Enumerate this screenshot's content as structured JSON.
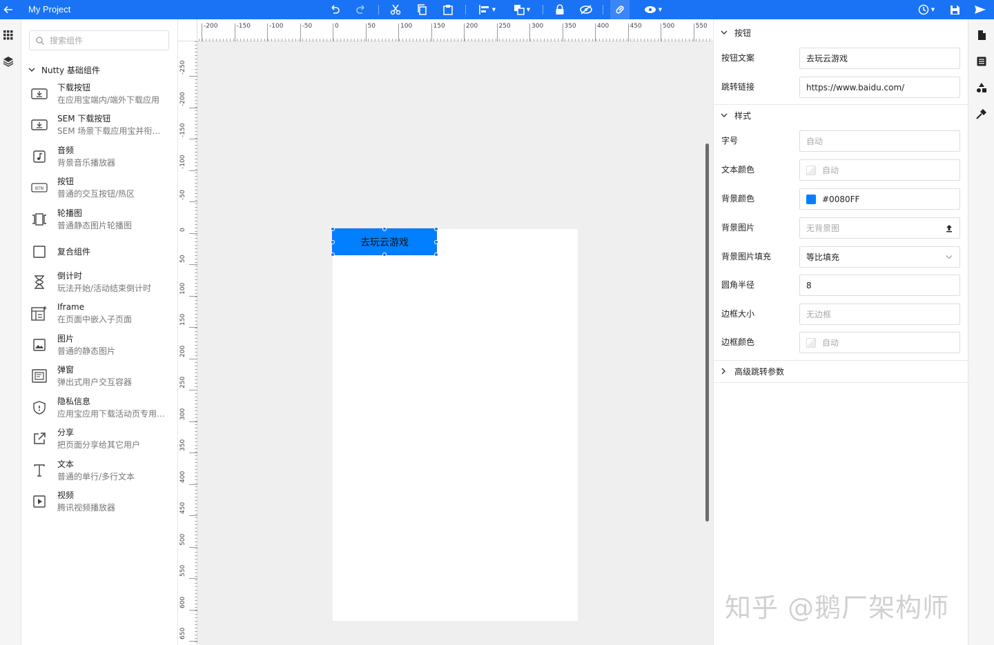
{
  "app": {
    "title": "My Project"
  },
  "colors": {
    "accent": "#1a73f5",
    "button_bg": "#0080FF"
  },
  "toolbar": {
    "icons": [
      "back-arrow-icon",
      "undo-icon",
      "redo-icon",
      "cut-icon",
      "copy-icon",
      "paste-icon",
      "align-icon",
      "arrange-icon",
      "lock-icon",
      "hide-icon",
      "link-icon",
      "preview-icon",
      "history-icon",
      "save-icon",
      "publish-icon"
    ]
  },
  "leftrail": {
    "icons": [
      "components-grid-icon",
      "layers-icon"
    ]
  },
  "leftpanel": {
    "search_placeholder": "搜索组件",
    "group_title": "Nutty 基础组件",
    "components": [
      {
        "name": "下载按钮",
        "desc": "在应用宝端内/端外下载应用",
        "icon": "download-button-icon"
      },
      {
        "name": "SEM 下载按钮",
        "desc": "SEM 场景下载应用宝并衔…",
        "icon": "sem-download-icon"
      },
      {
        "name": "音频",
        "desc": "背景音乐播放器",
        "icon": "audio-icon"
      },
      {
        "name": "按钮",
        "desc": "普通的交互按钮/热区",
        "icon": "button-icon"
      },
      {
        "name": "轮播图",
        "desc": "普通静态图片轮播图",
        "icon": "carousel-icon"
      },
      {
        "name": "复合组件",
        "desc": "",
        "icon": "composite-icon"
      },
      {
        "name": "倒计时",
        "desc": "玩法开始/活动结束倒计时",
        "icon": "hourglass-icon"
      },
      {
        "name": "Iframe",
        "desc": "在页面中嵌入子页面",
        "icon": "iframe-icon"
      },
      {
        "name": "图片",
        "desc": "普通的静态图片",
        "icon": "image-icon"
      },
      {
        "name": "弹窗",
        "desc": "弹出式用户交互容器",
        "icon": "popup-icon"
      },
      {
        "name": "隐私信息",
        "desc": "应用宝应用下载活动页专用…",
        "icon": "shield-icon"
      },
      {
        "name": "分享",
        "desc": "把页面分享给其它用户",
        "icon": "share-icon"
      },
      {
        "name": "文本",
        "desc": "普通的单行/多行文本",
        "icon": "text-icon"
      },
      {
        "name": "视频",
        "desc": "腾讯视频播放器",
        "icon": "video-icon"
      }
    ]
  },
  "ruler": {
    "h_labels": [
      "-200",
      "-150",
      "-100",
      "-50",
      "0",
      "50",
      "100",
      "150",
      "200",
      "250",
      "300",
      "350",
      "400",
      "450",
      "500",
      "550"
    ],
    "v_labels": [
      "-250",
      "-200",
      "-150",
      "-100",
      "-50",
      "0",
      "50",
      "100",
      "150",
      "200",
      "250",
      "300",
      "350",
      "400",
      "450",
      "500",
      "550",
      "600",
      "650"
    ]
  },
  "canvas": {
    "button_text": "去玩云游戏"
  },
  "props": {
    "button_section": "按钮",
    "button_text_label": "按钮文案",
    "button_text_value": "去玩云游戏",
    "link_label": "跳转链接",
    "link_value": "https://www.baidu.com/",
    "style_section": "样式",
    "font_size_label": "字号",
    "font_size_value": "自动",
    "text_color_label": "文本颜色",
    "text_color_value": "自动",
    "bg_color_label": "背景颜色",
    "bg_color_value": "#0080FF",
    "bg_image_label": "背景图片",
    "bg_image_value": "无背景图",
    "bg_fill_label": "背景图片填充",
    "bg_fill_value": "等比填充",
    "radius_label": "圆角半径",
    "radius_value": "8",
    "border_size_label": "边框大小",
    "border_size_value": "无边框",
    "border_color_label": "边框颜色",
    "border_color_value": "自动",
    "advanced_section": "高级跳转参数"
  },
  "rightrail": {
    "icons": [
      "page-icon",
      "data-icon",
      "shapes-icon",
      "plugin-icon"
    ]
  },
  "watermark": "知乎 @鹅厂架构师"
}
